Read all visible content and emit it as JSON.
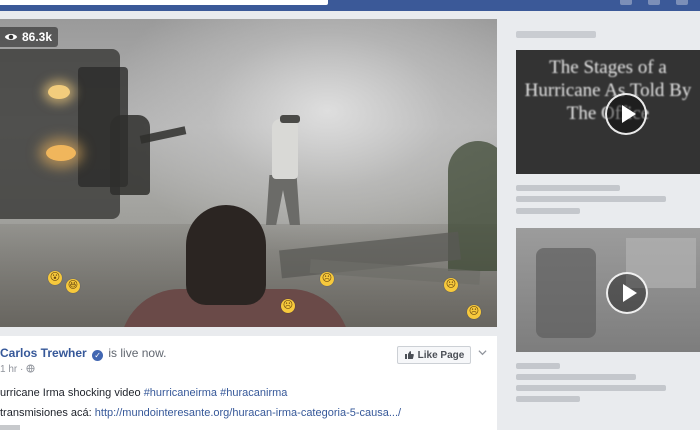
{
  "video": {
    "view_count": "86.3k",
    "reactions": [
      "wow",
      "haha",
      "sad",
      "sad",
      "sad",
      "sad"
    ]
  },
  "post": {
    "author": "Carlos Trewher",
    "live_status": "is live now.",
    "time": "1 hr ·",
    "like_page_label": "Like Page",
    "line1_text": "urricane Irma shocking video ",
    "hashtag1": "#hurricaneirma",
    "hashtag2": "#huracanirma",
    "line2_prefix": " transmisiones acá: ",
    "link": "http://mundointeresante.org/huracan-irma-categoria-5-causa.../"
  },
  "sidebar": {
    "thumb1_title": "The Stages of a Hurricane As Told By The Office"
  },
  "colors": {
    "facebook_blue": "#3b5998",
    "link_blue": "#365899",
    "reaction_yellow": "#f7c93c"
  }
}
